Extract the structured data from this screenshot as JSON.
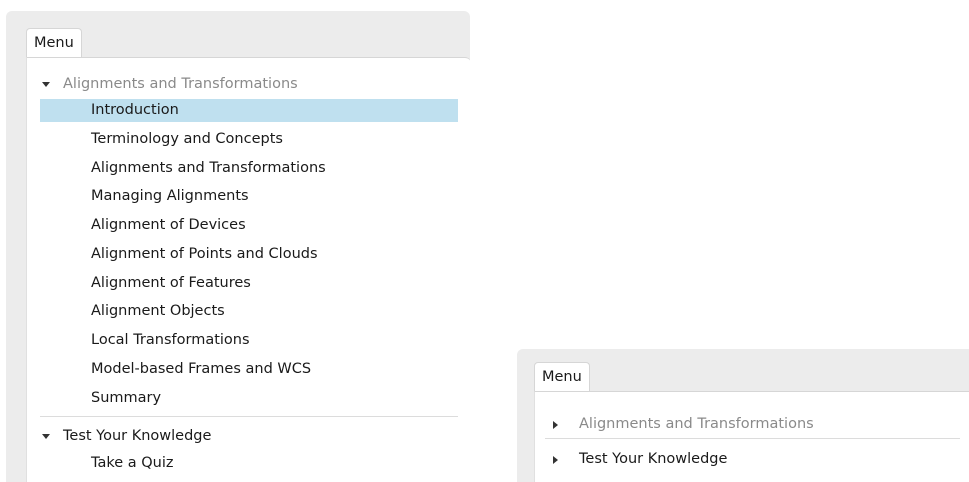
{
  "left_menu": {
    "tab_label": "Menu",
    "sections": [
      {
        "title": "Alignments and Transformations",
        "items": [
          "Introduction",
          "Terminology and Concepts",
          "Alignments and Transformations",
          "Managing Alignments",
          "Alignment of Devices",
          "Alignment of Points and Clouds",
          "Alignment of Features",
          "Alignment Objects",
          "Local Transformations",
          "Model-based Frames and WCS",
          "Summary"
        ]
      },
      {
        "title": "Test Your Knowledge",
        "items": [
          "Take a Quiz"
        ]
      }
    ],
    "selected_item": "Introduction"
  },
  "right_menu": {
    "tab_label": "Menu",
    "sections": [
      {
        "title": "Alignments and Transformations"
      },
      {
        "title": "Test Your Knowledge"
      }
    ]
  },
  "colors": {
    "selection": "#bfe0ef",
    "panel_bg": "#ececec",
    "muted_text": "#8a8a8a"
  },
  "icons": {
    "expanded": "triangle-down-icon",
    "collapsed": "triangle-right-icon"
  }
}
